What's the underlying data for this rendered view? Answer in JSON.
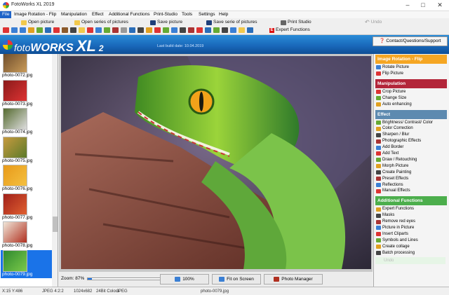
{
  "window": {
    "title": "FotoWorks XL 2019",
    "controls": [
      "minimize",
      "maximize",
      "close"
    ]
  },
  "menu": [
    "File",
    "Image Rotation - Flip",
    "Manipulation",
    "Effect",
    "Additional Functions",
    "Print-Studio",
    "Tools",
    "Settings",
    "Help"
  ],
  "toolbar": {
    "open_picture": "Open picture",
    "open_series": "Open series of pictures",
    "save_picture": "Save picture",
    "save_series": "Save serie of pictures",
    "print_studio": "Print Studio",
    "undo": "Undo",
    "expert_functions": "Expert Functions"
  },
  "header": {
    "logo_foto": "foto",
    "logo_works": "WORKS",
    "logo_xl": "XL",
    "logo_version": "2",
    "build_date": "Last build date: 10.04.2019",
    "contact": "Contact/Questions/Support"
  },
  "thumbnails": [
    {
      "label": "photo-0072.jpg",
      "colors": [
        "#6b4a2a",
        "#c99b59"
      ]
    },
    {
      "label": "photo-0073.jpg",
      "colors": [
        "#8a1a1a",
        "#d33"
      ]
    },
    {
      "label": "photo-0074.jpg",
      "colors": [
        "#556b2f",
        "#ddd"
      ]
    },
    {
      "label": "photo-0075.jpg",
      "colors": [
        "#c79a3e",
        "#5b7a2a"
      ]
    },
    {
      "label": "photo-0076.jpg",
      "colors": [
        "#e89a1a",
        "#f4c040"
      ]
    },
    {
      "label": "photo-0077.jpg",
      "colors": [
        "#a0201a",
        "#e06030"
      ]
    },
    {
      "label": "photo-0078.jpg",
      "colors": [
        "#f0e6d8",
        "#b03020"
      ]
    },
    {
      "label": "photo-0079.jpg",
      "colors": [
        "#2f8a2f",
        "#7bc94a"
      ],
      "selected": true
    }
  ],
  "bottombar": {
    "zoom_label": "Zoom: 87%",
    "zoom_value": 0.05,
    "zoom100": "100%",
    "fit": "Fit on Screen",
    "photo_manager": "Photo Manager"
  },
  "sidebar": {
    "sections": [
      {
        "title": "Image Rotation - Flip",
        "color": "#f5a623",
        "items": [
          "Rotate Picture",
          "Flip Picture"
        ]
      },
      {
        "title": "Manipulation",
        "color": "#b3263a",
        "items": [
          "Crop Picture",
          "Change Size",
          "Auto enhancing"
        ]
      },
      {
        "title": "Effect",
        "color": "#5d8ab0",
        "items": [
          "Brightness/ Contrast/ Color",
          "Color Correction",
          "Sharpen / Blur",
          "Photographic Effects",
          "Add Border",
          "Add Text",
          "Draw / Retouching",
          "Morph Picture",
          "Create Painting",
          "Preset Effects",
          "Reflections",
          "Manual Effects"
        ]
      },
      {
        "title": "Additional Functions",
        "color": "#4cae4c",
        "items": [
          "Expert Functions",
          "Masks",
          "Remove red eyes",
          "Picture in Picture",
          "Insert Cliparts",
          "Symbols and Lines",
          "Create collage",
          "Batch processing"
        ]
      }
    ],
    "undo": "Undo"
  },
  "status": {
    "coords": "X:15 Y:486",
    "format": "JPEG  4:2:2",
    "dims": "1024x682",
    "colors": "24Bit Colors",
    "type": "JPEG",
    "filename": "photo-0079.jpg"
  }
}
